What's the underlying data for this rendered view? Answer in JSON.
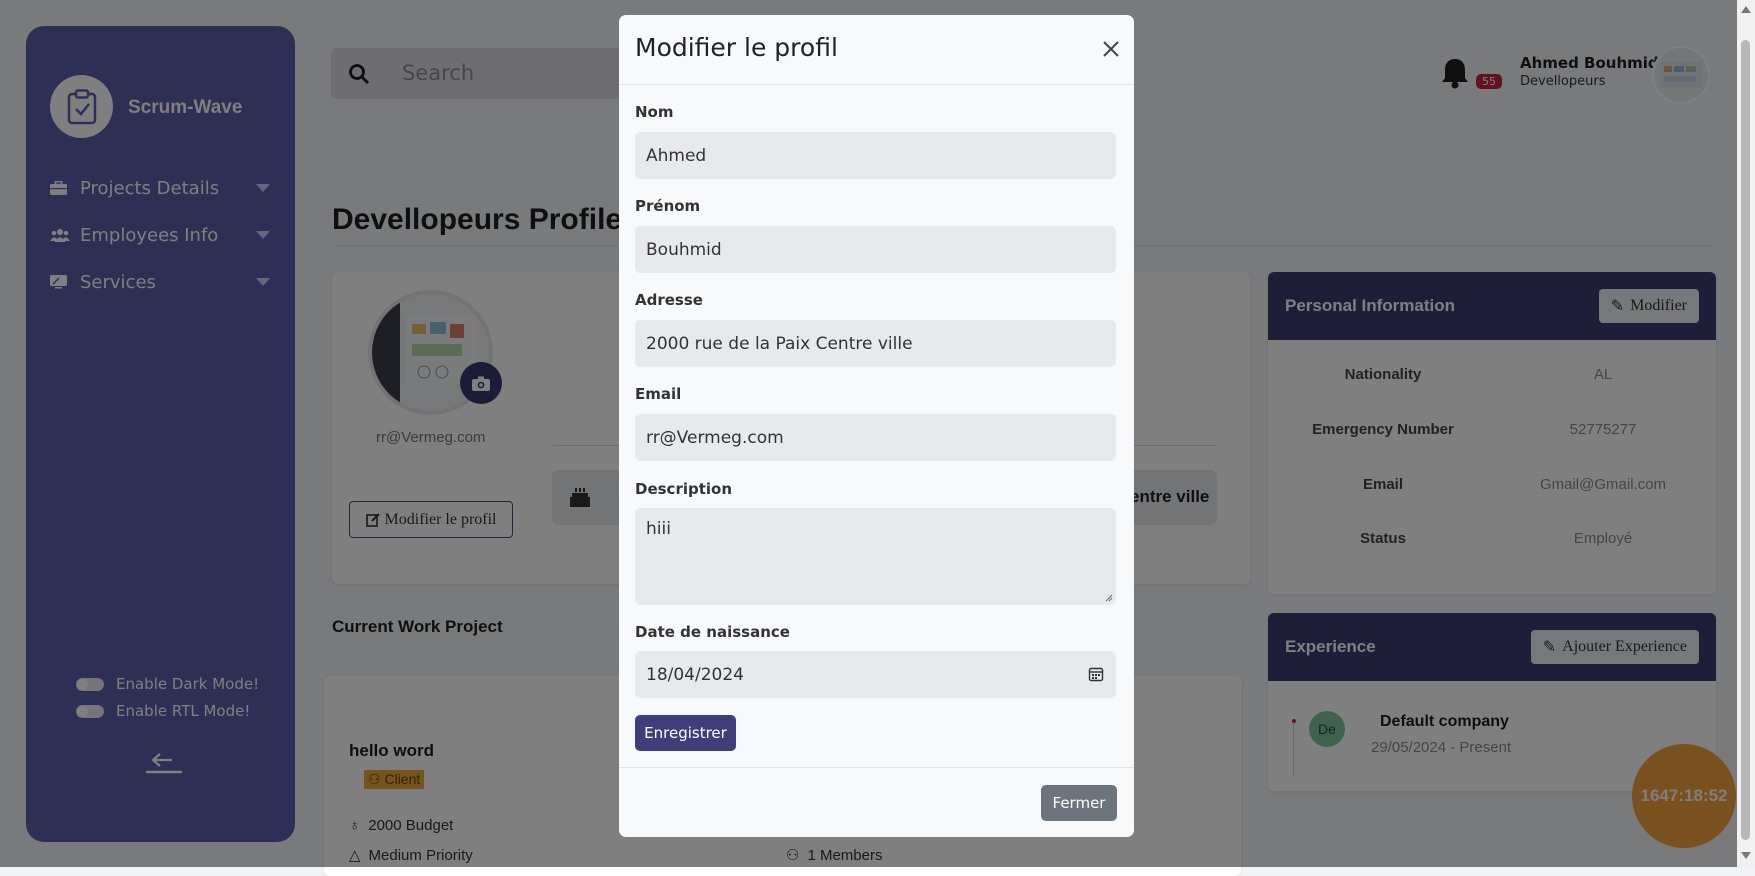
{
  "sidebar": {
    "brand": "Scrum-Wave",
    "items": [
      {
        "label": "Projects Details",
        "icon": "briefcase-icon"
      },
      {
        "label": "Employees Info",
        "icon": "users-icon"
      },
      {
        "label": "Services",
        "icon": "monitor-icon"
      }
    ],
    "toggles": {
      "dark": "Enable Dark Mode!",
      "rtl": "Enable RTL Mode!"
    }
  },
  "header": {
    "search_placeholder": "Search",
    "notifications": "55",
    "user_name": "Ahmed Bouhmid",
    "user_role": "Devellopeurs"
  },
  "page": {
    "title": "Devellopeurs Profile",
    "email": "rr@Vermeg.com",
    "edit_button": "Modifier le profil",
    "address_fragment": "entre ville",
    "current_work_title": "Current Work Project",
    "project": {
      "name": "hello word",
      "client": "Client",
      "budget": "2000 Budget",
      "priority": "Medium Priority",
      "members": "1 Members"
    }
  },
  "personal_info": {
    "title": "Personal Information",
    "button": "Modifier",
    "rows": [
      {
        "key": "Nationality",
        "value": "AL"
      },
      {
        "key": "Emergency Number",
        "value": "52775277"
      },
      {
        "key": "Email",
        "value": "Gmail@Gmail.com"
      },
      {
        "key": "Status",
        "value": "Employé"
      }
    ]
  },
  "experience": {
    "title": "Experience",
    "button": "Ajouter Experience",
    "badge": "De",
    "company": "Default company",
    "dates": "29/05/2024 - Present"
  },
  "timer": "1647:18:52",
  "modal": {
    "title": "Modifier le profil",
    "fields": {
      "nom_label": "Nom",
      "nom_value": "Ahmed",
      "prenom_label": "Prénom",
      "prenom_value": "Bouhmid",
      "adresse_label": "Adresse",
      "adresse_value": "2000 rue de la Paix Centre ville",
      "email_label": "Email",
      "email_value": "rr@Vermeg.com",
      "description_label": "Description",
      "description_value": "hiii",
      "date_label": "Date de naissance",
      "date_value": "18/04/2024"
    },
    "save_button": "Enregistrer",
    "close_button": "Fermer"
  },
  "colors": {
    "sidebar": "#5d5ea8",
    "panel_header": "#3c3d73",
    "accent_button": "#3e3f7a",
    "timer": "#f2a23c",
    "badge": "#c8273d"
  }
}
